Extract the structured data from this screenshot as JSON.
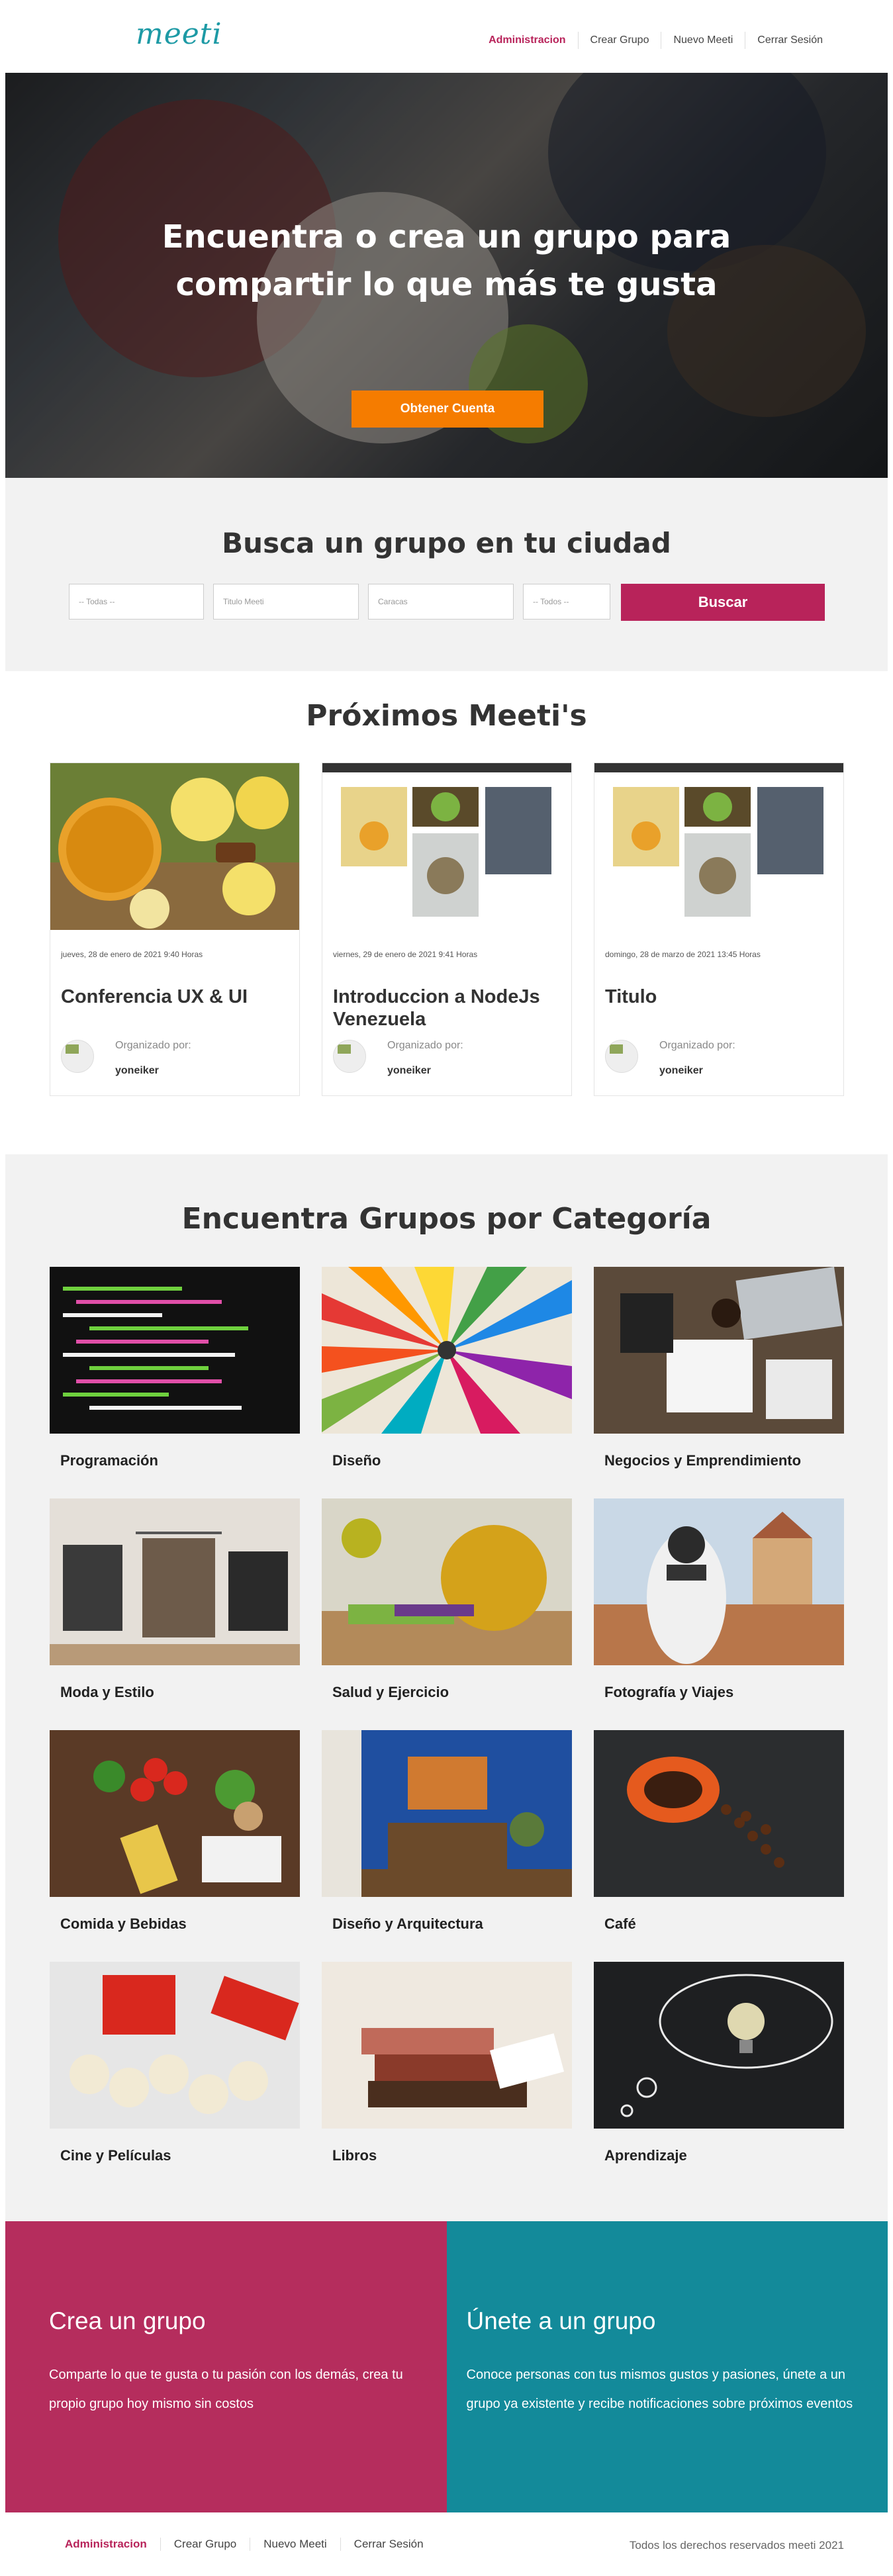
{
  "header": {
    "logo": "meeti",
    "nav": [
      "Administracion",
      "Crear Grupo",
      "Nuevo Meeti",
      "Cerrar Sesión"
    ]
  },
  "hero": {
    "title_line1": "Encuentra o crea un grupo para",
    "title_line2": "compartir lo que más te gusta",
    "cta": "Obtener Cuenta"
  },
  "search": {
    "title": "Busca un grupo en tu ciudad",
    "category_placeholder": "-- Todas --",
    "title_placeholder": "Titulo Meeti",
    "city_placeholder": "Caracas",
    "country_placeholder": "-- Todos --",
    "button": "Buscar"
  },
  "meetis": {
    "title": "Próximos Meeti's",
    "organizer_label": "Organizado por:",
    "items": [
      {
        "date": "jueves, 28 de enero de 2021 9:40 Horas",
        "title": "Conferencia UX & UI",
        "user": "yoneiker"
      },
      {
        "date": "viernes, 29 de enero de 2021 9:41 Horas",
        "title": "Introduccion a NodeJs Venezuela",
        "user": "yoneiker"
      },
      {
        "date": "domingo, 28 de marzo de 2021 13:45 Horas",
        "title": "Titulo",
        "user": "yoneiker"
      }
    ]
  },
  "categories": {
    "title": "Encuentra Grupos por Categoría",
    "items": [
      "Programación",
      "Diseño",
      "Negocios y Emprendimiento",
      "Moda y Estilo",
      "Salud y Ejercicio",
      "Fotografía y Viajes",
      "Comida y Bebidas",
      "Diseño y Arquitectura",
      "Café",
      "Cine y Películas",
      "Libros",
      "Aprendizaje"
    ]
  },
  "cta": {
    "create_title": "Crea un grupo",
    "create_text": "Comparte lo que te gusta o tu pasión con los demás, crea tu propio grupo hoy mismo sin costos",
    "join_title": "Únete a un grupo",
    "join_text": "Conoce personas con tus mismos gustos y pasiones, únete a un grupo ya existente y recibe notificaciones sobre próximos eventos"
  },
  "footer": {
    "nav": [
      "Administracion",
      "Crear Grupo",
      "Nuevo Meeti",
      "Cerrar Sesión"
    ],
    "copyright": "Todos los derechos reservados meeti 2021"
  },
  "colors": {
    "brand": "#1d9aa5",
    "accent": "#b8235a",
    "orange": "#f57c00",
    "teal": "#138a9a"
  }
}
